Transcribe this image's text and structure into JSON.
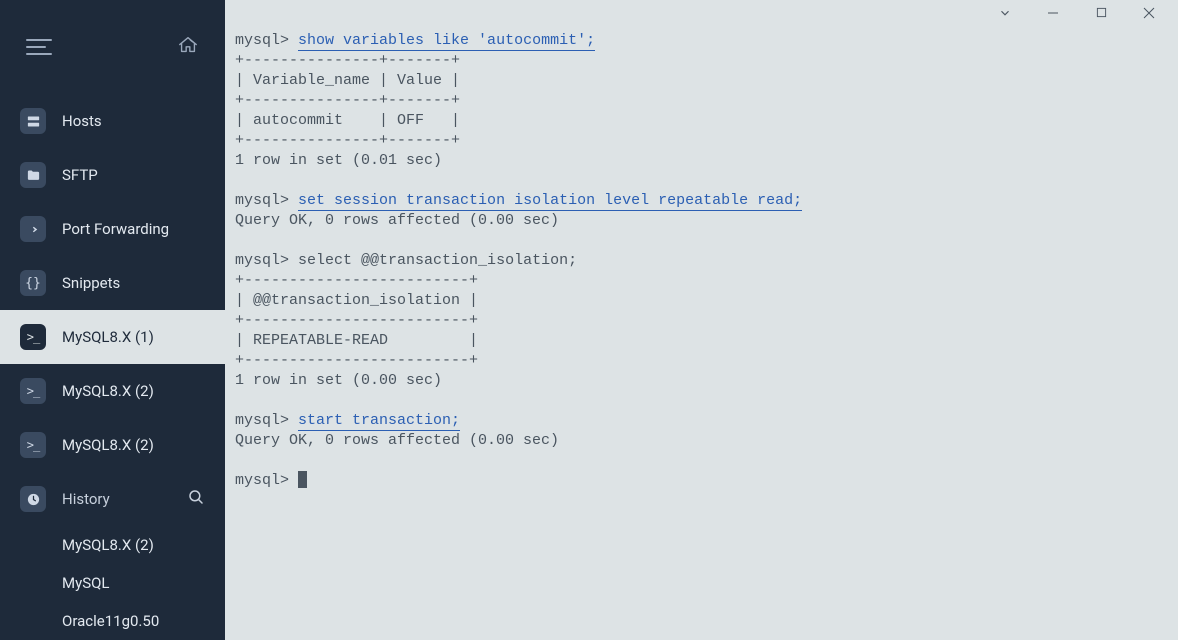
{
  "sidebar": {
    "items": [
      {
        "label": "Hosts",
        "active": false
      },
      {
        "label": "SFTP",
        "active": false
      },
      {
        "label": "Port Forwarding",
        "active": false
      },
      {
        "label": "Snippets",
        "active": false
      },
      {
        "label": "MySQL8.X (1)",
        "active": true
      },
      {
        "label": "MySQL8.X (2)",
        "active": false
      },
      {
        "label": "MySQL8.X (2)",
        "active": false
      }
    ],
    "history_label": "History",
    "history_items": [
      "MySQL8.X (2)",
      "MySQL",
      "Oracle11g0.50"
    ]
  },
  "terminal": {
    "prompt": "mysql>",
    "blocks": {
      "b0": {
        "cmd": "show variables like 'autocommit';",
        "out": "+---------------+-------+\n| Variable_name | Value |\n+---------------+-------+\n| autocommit    | OFF   |\n+---------------+-------+\n1 row in set (0.01 sec)"
      },
      "b1": {
        "cmd": "set session transaction isolation level repeatable read;",
        "out": "Query OK, 0 rows affected (0.00 sec)"
      },
      "b2": {
        "cmd": "select @@transaction_isolation;",
        "out": "+-------------------------+\n| @@transaction_isolation |\n+-------------------------+\n| REPEATABLE-READ         |\n+-------------------------+\n1 row in set (0.00 sec)"
      },
      "b3": {
        "cmd": "start transaction;",
        "out": "Query OK, 0 rows affected (0.00 sec)"
      }
    }
  }
}
